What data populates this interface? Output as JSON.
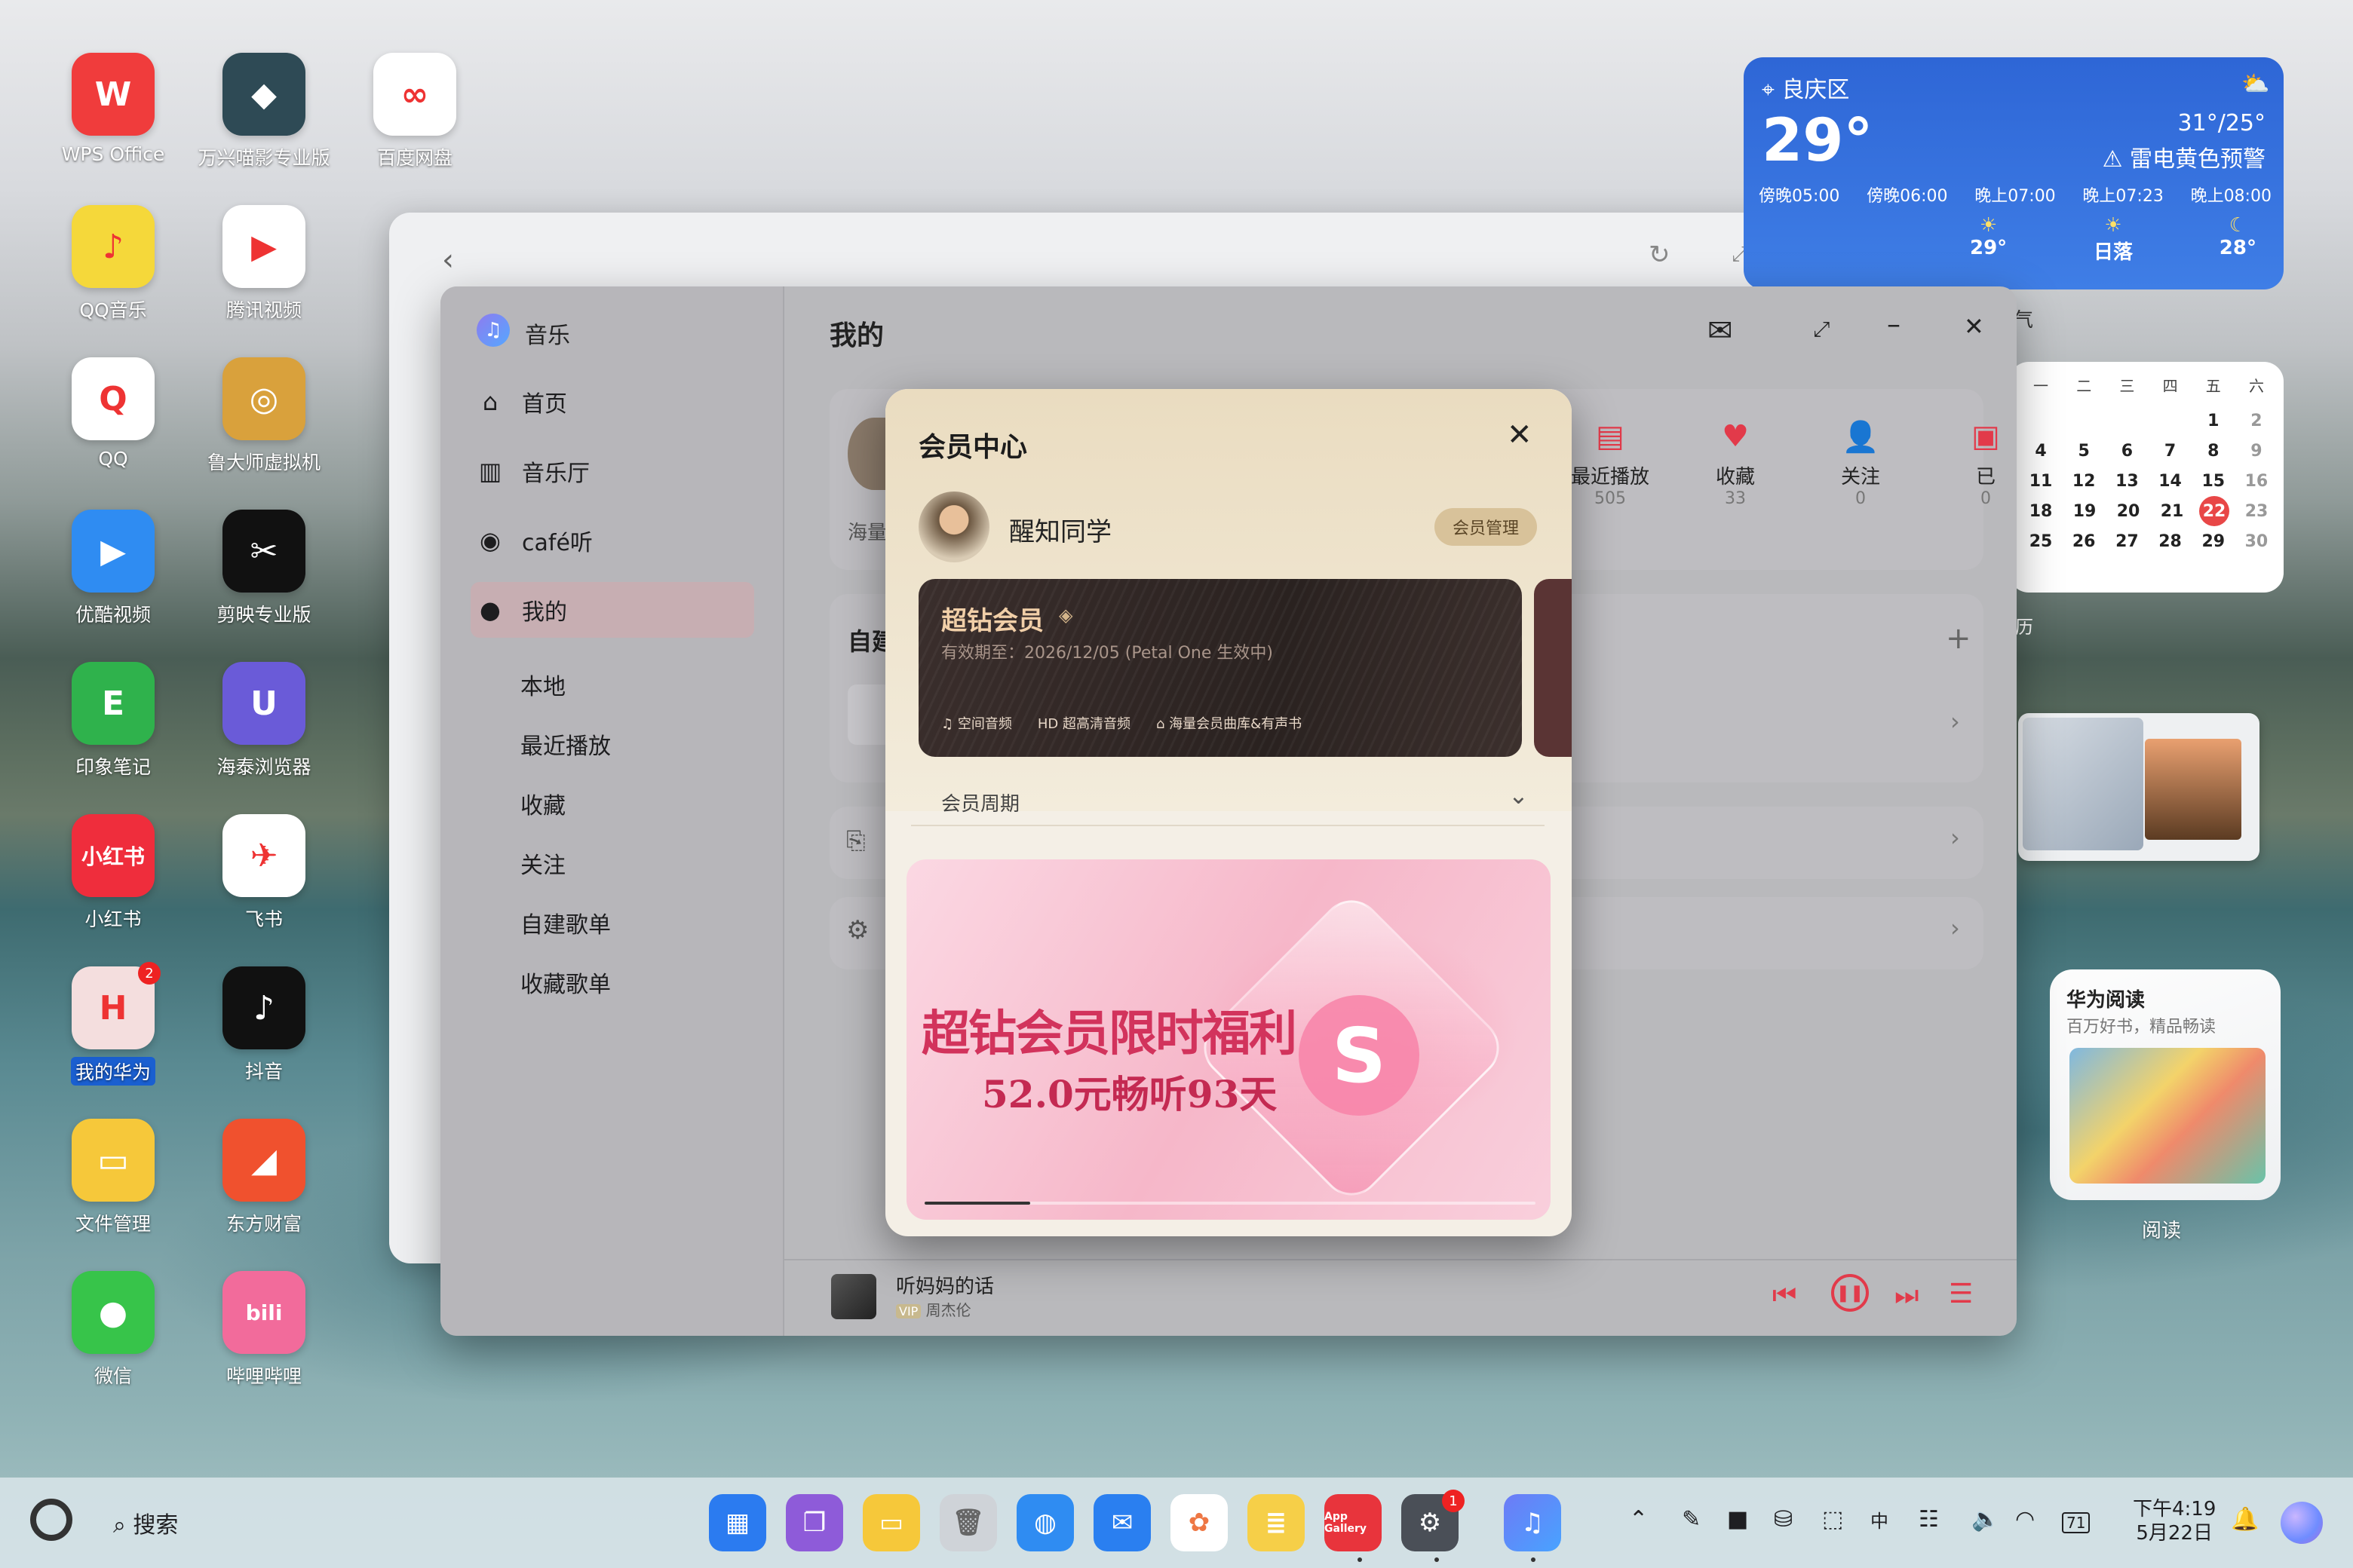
{
  "desktop": {
    "icons": [
      {
        "label": "WPS Office",
        "glyph": "W",
        "bg": "#f03c3c"
      },
      {
        "label": "万兴喵影专业版",
        "glyph": "◆",
        "bg": "#2e4a55"
      },
      {
        "label": "百度网盘",
        "glyph": "∞",
        "bg": "#ffffff"
      },
      {
        "label": "QQ音乐",
        "glyph": "♪",
        "bg": "#f5d83a"
      },
      {
        "label": "腾讯视频",
        "glyph": "▶",
        "bg": "#ffffff"
      },
      {
        "label": "QQ",
        "glyph": "Q",
        "bg": "#ffffff"
      },
      {
        "label": "鲁大师虚拟机",
        "glyph": "◎",
        "bg": "#d9a13c"
      },
      {
        "label": "优酷视频",
        "glyph": "▶",
        "bg": "#2f8cf2"
      },
      {
        "label": "剪映专业版",
        "glyph": "✂",
        "bg": "#111111"
      },
      {
        "label": "印象笔记",
        "glyph": "E",
        "bg": "#2fb24c"
      },
      {
        "label": "海泰浏览器",
        "glyph": "U",
        "bg": "#6a5bd8"
      },
      {
        "label": "小红书",
        "glyph": "小红书",
        "bg": "#ef2d3c"
      },
      {
        "label": "飞书",
        "glyph": "✈",
        "bg": "#ffffff"
      },
      {
        "label": "我的华为",
        "glyph": "H",
        "bg": "#f4dede",
        "badge": "2"
      },
      {
        "label": "抖音",
        "glyph": "♪",
        "bg": "#111111"
      },
      {
        "label": "文件管理",
        "glyph": "▭",
        "bg": "#f6c83a"
      },
      {
        "label": "东方财富",
        "glyph": "◢",
        "bg": "#f0512e"
      },
      {
        "label": "微信",
        "glyph": "●",
        "bg": "#37c44a"
      },
      {
        "label": "哔哩哔哩",
        "glyph": "bili",
        "bg": "#f26b9b"
      }
    ]
  },
  "weather": {
    "location": "良庆区",
    "temp": "29°",
    "range": "31°/25°",
    "alert": "雷电黄色预警",
    "times": [
      "傍晚05:00",
      "傍晚06:00",
      "晚上07:00",
      "晚上07:23",
      "晚上08:00"
    ],
    "forecast": [
      {
        "icon": "☀",
        "label": "29°"
      },
      {
        "icon": "☀",
        "label": "日落"
      },
      {
        "icon": "☾",
        "label": "28°"
      }
    ]
  },
  "calendar": {
    "weekdays": [
      "一",
      "二",
      "三",
      "四",
      "五",
      "六"
    ],
    "rows": [
      [
        "",
        "",
        "",
        "",
        "1",
        "2"
      ],
      [
        "4",
        "5",
        "6",
        "7",
        "8",
        "9"
      ],
      [
        "11",
        "12",
        "13",
        "14",
        "15",
        "16"
      ],
      [
        "18",
        "19",
        "20",
        "21",
        "22",
        "23"
      ],
      [
        "25",
        "26",
        "27",
        "28",
        "29",
        "30"
      ]
    ],
    "today": "22"
  },
  "reading_widget": {
    "title": "华为阅读",
    "subtitle": "百万好书，精品畅读",
    "label": "阅读"
  },
  "music": {
    "app_name": "音乐",
    "nav": [
      {
        "icon": "⌂",
        "label": "首页"
      },
      {
        "icon": "▥",
        "label": "音乐厅"
      },
      {
        "icon": "◉",
        "label": "café听"
      },
      {
        "icon": "●",
        "label": "我的"
      }
    ],
    "sub_nav": [
      "本地",
      "最近播放",
      "收藏",
      "关注",
      "自建歌单",
      "收藏歌单"
    ],
    "page_title": "我的",
    "stats": [
      {
        "label": "最近播放",
        "count": "505"
      },
      {
        "label": "收藏",
        "count": "33"
      },
      {
        "label": "关注",
        "count": "0"
      },
      {
        "label": "已",
        "count": "0"
      }
    ],
    "peek": {
      "haishi": "海量",
      "zijian": "自建",
      "chao": "超",
      "you": "有"
    },
    "now_playing": {
      "title": "听妈妈的话",
      "vip": "VIP",
      "artist": "周杰伦"
    }
  },
  "member": {
    "title": "会员中心",
    "user_name": "醒知同学",
    "manage": "会员管理",
    "card_title": "超钻会员",
    "card_validity": "有效期至：2026/12/05 (Petal One 生效中)",
    "card_perks": [
      "空间音频",
      "超高清音频",
      "海量会员曲库&有声书"
    ],
    "cycle_label": "会员周期",
    "promo_line1": "超钻会员限时福利",
    "promo_line2": "52.0元畅听93天"
  },
  "taskbar": {
    "search": "搜索",
    "time": "下午4:19",
    "date": "5月22日",
    "battery": "71",
    "dock_badge": "1",
    "appgallery": "App Gallery"
  }
}
